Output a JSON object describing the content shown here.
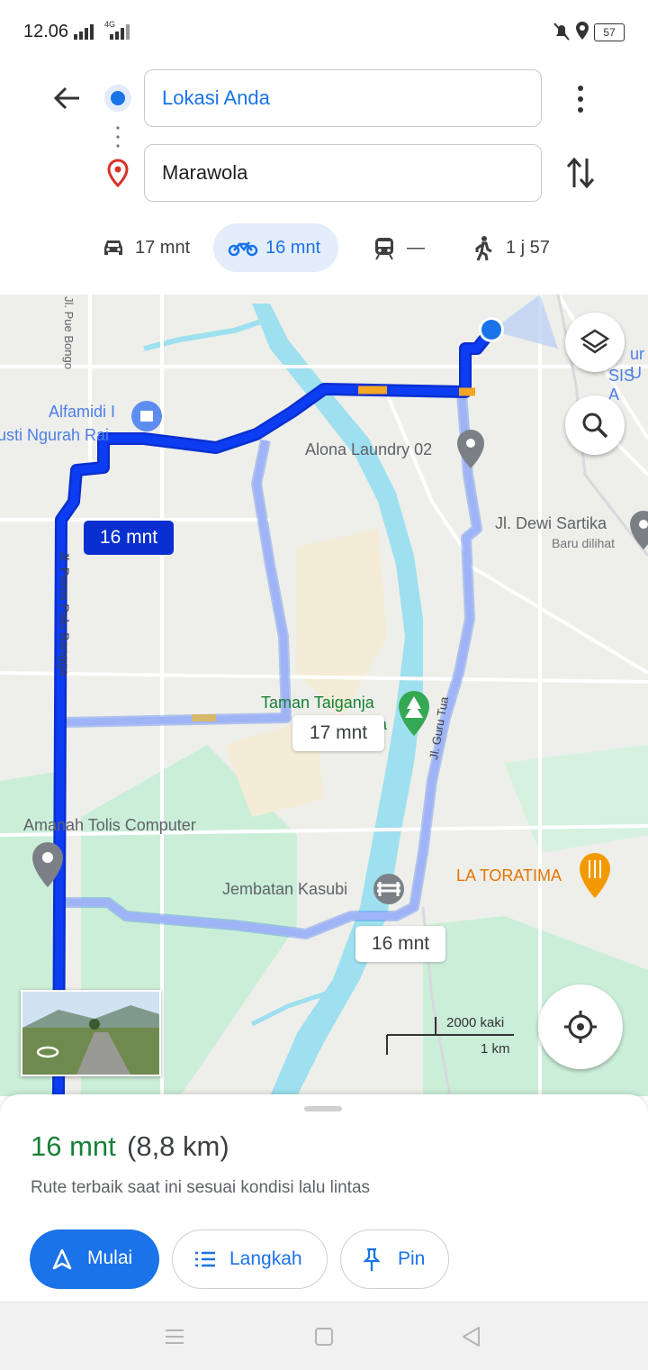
{
  "status_bar": {
    "time": "12.06",
    "network": "4G",
    "battery": "57"
  },
  "directions": {
    "origin": "Lokasi Anda",
    "destination": "Marawola"
  },
  "modes": [
    {
      "name": "car",
      "label": "17 mnt"
    },
    {
      "name": "motorcycle",
      "label": "16 mnt"
    },
    {
      "name": "transit",
      "label": "—"
    },
    {
      "name": "walk",
      "label": "1 j 57"
    }
  ],
  "map": {
    "roads": {
      "pue_bongo": "Jl. Pue Bongo",
      "poros": "Jl. Poros Palu Bangga",
      "guru_tua": "Jl. Guru Tua"
    },
    "places": {
      "alfamidi": "Alfamidi I",
      "gusti": "usti Ngurah Rai",
      "alona": "Alona Laundry 02",
      "dewi": "Jl. Dewi Sartika",
      "dewi_sub": "Baru dilihat",
      "taman": "Taman Taiganja",
      "taman_tail": "a",
      "amanah": "Amanah Tolis Computer",
      "jembatan": "Jembatan Kasubi",
      "toratima": "LA TORATIMA",
      "edge1": "ur U",
      "edge2": "SIS A"
    },
    "route_labels": {
      "primary": "16 mnt",
      "alt1": "17 mnt",
      "alt2": "16 mnt"
    },
    "scale": {
      "top": "2000 kaki",
      "bottom": "1 km"
    }
  },
  "sheet": {
    "duration": "16 mnt",
    "distance": "(8,8 km)",
    "note": "Rute terbaik saat ini sesuai kondisi lalu lintas",
    "buttons": {
      "start": "Mulai",
      "steps": "Langkah",
      "pin": "Pin"
    }
  },
  "colors": {
    "accent": "#1a73e8",
    "route": "#0d3df2",
    "alt_route": "#9fb4f7",
    "green": "#188038"
  }
}
